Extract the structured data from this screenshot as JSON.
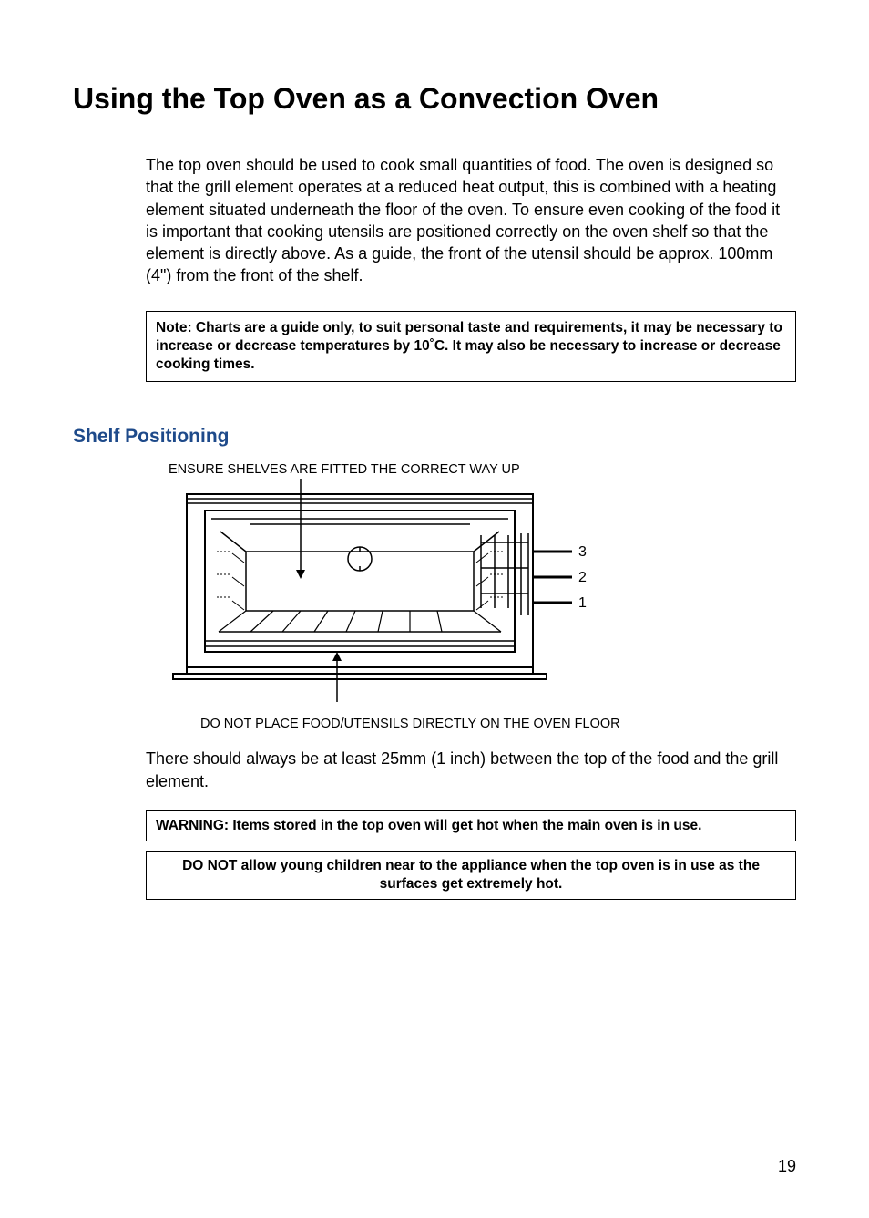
{
  "heading": "Using the Top Oven as a Convection Oven",
  "intro": "The top oven should be used to cook small quantities of food. The oven is designed so that the grill element operates at a reduced heat output, this is combined with a heating element situated underneath the floor of the oven. To ensure even cooking of the food it is important that cooking utensils are positioned correctly on the oven shelf so that the element is directly above. As a guide, the front of the utensil should be approx. 100mm (4\") from the front of the shelf.",
  "note": "Note: Charts are a guide only, to suit personal taste and requirements, it may be necessary to increase or decrease temperatures by 10˚C. It may also be necessary to increase or decrease cooking times.",
  "shelf_heading": "Shelf Positioning",
  "diagram": {
    "top_label": "ENSURE SHELVES ARE FITTED THE CORRECT WAY UP",
    "bottom_label": "DO NOT PLACE FOOD/UTENSILS DIRECTLY ON THE OVEN FLOOR",
    "shelf_numbers": [
      "3",
      "2",
      "1"
    ]
  },
  "clearance": "There should always be at least 25mm (1 inch) between the top of the food and the grill element.",
  "warning1": "WARNING: Items stored in the top oven will get hot when the main oven is in use.",
  "warning2": "DO NOT allow young children near to the appliance when the top oven is in use as the surfaces get extremely hot.",
  "page_number": "19"
}
